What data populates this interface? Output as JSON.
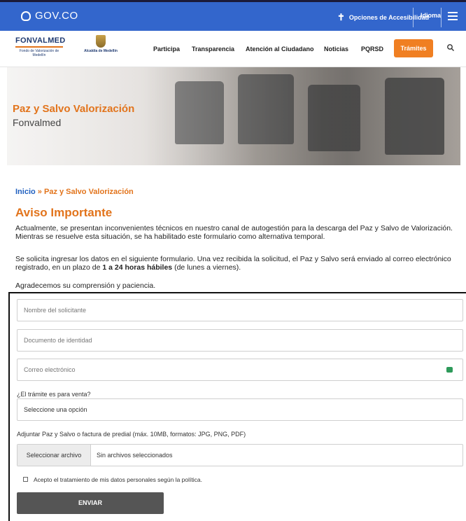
{
  "gov_bar": {
    "logo_text": "GOV.CO",
    "accessibility_label": "Opciones de Accesibilidad",
    "language_label": "Idioma"
  },
  "header": {
    "brand_name": "FONVALMED",
    "brand_subtitle": "Fondo de Valorización de Medellín",
    "alcaldia_name": "Alcaldía de Medellín",
    "nav": [
      "Participa",
      "Transparencia",
      "Atención al Ciudadano",
      "Noticias",
      "PQRSD"
    ],
    "cta_label": "Trámites"
  },
  "hero": {
    "title": "Paz y Salvo Valorización",
    "subtitle": "Fonvalmed"
  },
  "breadcrumb": {
    "home": "Inicio",
    "separator": "»",
    "current": "Paz y Salvo Valorización"
  },
  "notice": {
    "heading": "Aviso Importante",
    "paragraph1": "Actualmente, se presentan inconvenientes técnicos en nuestro canal de autogestión para la descarga del Paz y Salvo de Valorización. Mientras se resuelve esta situación, se ha habilitado este formulario como alternativa temporal.",
    "paragraph2_before": "Se solicita ingresar los datos en el siguiente formulario. Una vez recibida la solicitud, el Paz y Salvo será enviado al correo electrónico registrado, en un plazo de ",
    "paragraph2_bold": "1 a 24 horas hábiles",
    "paragraph2_after": " (de lunes a viernes).",
    "paragraph3": "Agradecemos su comprensión y paciencia."
  },
  "form": {
    "name_placeholder": "Nombre del solicitante",
    "id_placeholder": "Documento de identidad",
    "email_placeholder": "Correo electrónico",
    "sale_question": "¿El trámite es para venta?",
    "sale_select_value": "Seleccione una opción",
    "attach_label": "Adjuntar Paz y Salvo o factura de predial (máx. 10MB, formatos: JPG, PNG, PDF)",
    "file_button": "Seleccionar archivo",
    "file_status": "Sin archivos seleccionados",
    "consent_label": "Acepto el tratamiento de mis datos personales según la política.",
    "submit_label": "ENVIAR"
  },
  "colors": {
    "gov_blue": "#3366cc",
    "accent_orange": "#e2741c",
    "cta_orange": "#f07f22",
    "link_blue": "#1f5fbf",
    "submit_gray": "#555555"
  }
}
